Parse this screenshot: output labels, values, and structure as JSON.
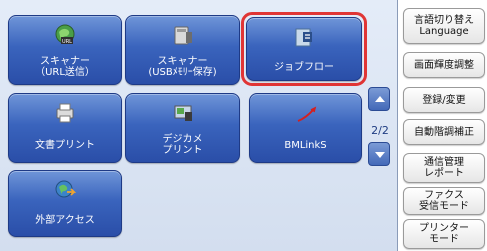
{
  "services": [
    {
      "label": "スキャナー\n（URL送信）",
      "icon": "url-scan-icon"
    },
    {
      "label": "スキャナー\n(USBﾒﾓﾘｰ保存)",
      "icon": "usb-scan-icon"
    },
    {
      "label": "ジョブフロー",
      "icon": "job-flow-icon"
    },
    {
      "label": "文書プリント",
      "icon": "document-print-icon"
    },
    {
      "label": "デジカメ\nプリント",
      "icon": "digital-camera-print-icon"
    },
    {
      "label": "BMLinkS",
      "icon": "bmlinks-icon"
    },
    {
      "label": "外部アクセス",
      "icon": "external-access-icon"
    }
  ],
  "pager": {
    "text": "2/2"
  },
  "side_buttons": [
    {
      "label": "言語切り替え\nLanguage"
    },
    {
      "label": "画面輝度調整"
    },
    {
      "label": "登録/変更"
    },
    {
      "label": "自動階調補正"
    },
    {
      "label": "通信管理\nレポート"
    },
    {
      "label": "ファクス\n受信モード"
    },
    {
      "label": "プリンター\nモード"
    }
  ],
  "colors": {
    "selected_ring": "#e03535",
    "button_blue": "#3a64bd"
  }
}
